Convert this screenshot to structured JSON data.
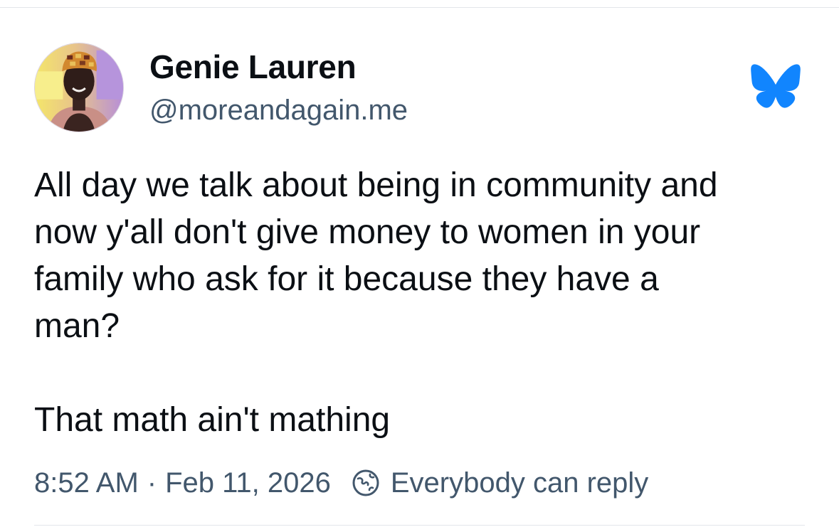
{
  "post": {
    "author": {
      "display_name": "Genie Lauren",
      "handle": "@moreandagain.me",
      "avatar_icon": "profile-photo"
    },
    "text_lines": [
      "All day we talk about being in community and",
      "now y'all don't give money to women in your",
      "family who ask for it because they have a",
      "man?"
    ],
    "text_final": "That math ain't mathing",
    "time": "8:52 AM",
    "separator": "·",
    "date": "Feb 11, 2026",
    "reply_setting": "Everybody can reply",
    "reply_icon": "globe-icon"
  },
  "platform": {
    "logo_icon": "butterfly-icon",
    "accent_color": "#1185fe"
  },
  "colors": {
    "text_primary": "#0b0f14",
    "text_secondary": "#42576c",
    "divider": "#e3e6ea"
  }
}
